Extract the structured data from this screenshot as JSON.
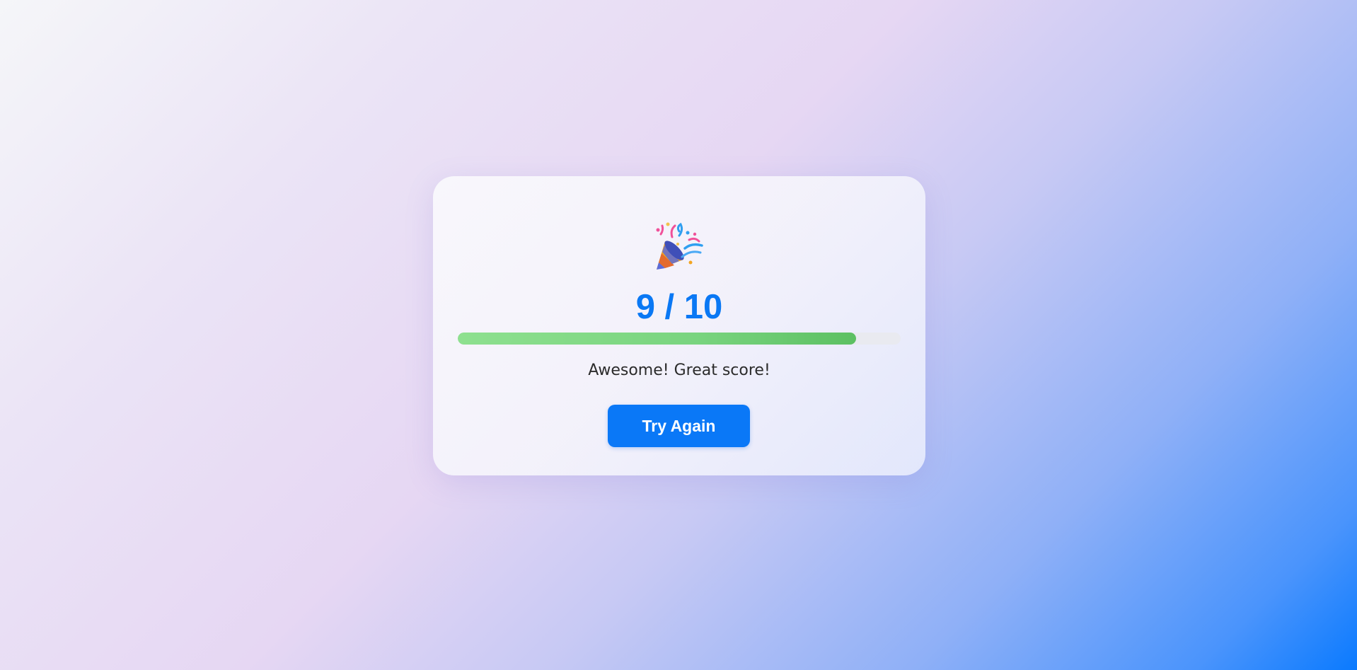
{
  "result": {
    "icon": "party-popper-icon",
    "score_text": "9 / 10",
    "score": 9,
    "total": 10,
    "progress_fraction": 0.9,
    "message": "Awesome! Great score!",
    "button_label": "Try Again"
  },
  "colors": {
    "accent": "#0a78f7",
    "progress": "#6acb70"
  }
}
